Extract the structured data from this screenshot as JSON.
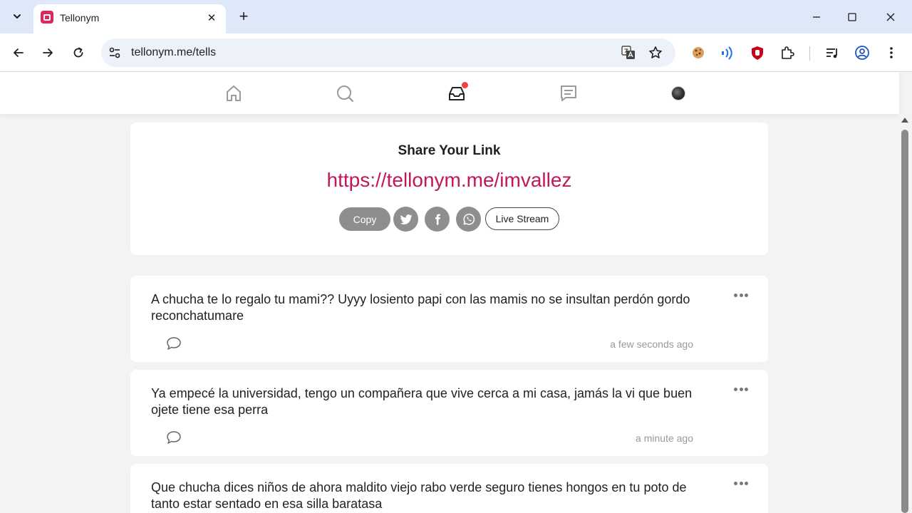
{
  "browser": {
    "tab_title": "Tellonym",
    "url": "tellonym.me/tells",
    "tab_close": "✕",
    "new_tab": "+"
  },
  "share": {
    "title": "Share Your Link",
    "link": "https://tellonym.me/imvallez",
    "copy_label": "Copy",
    "live_label": "Live Stream"
  },
  "tells": [
    {
      "text": "A chucha te lo regalo tu mami?? Uyyy losiento papi con las mamis no se insultan perdón gordo reconchatumare",
      "time": "a few seconds ago"
    },
    {
      "text": "Ya empecé la universidad, tengo un compañera que vive cerca a mi casa, jamás la vi que buen ojete tiene esa perra",
      "time": "a minute ago"
    },
    {
      "text": "Que chucha dices niños de ahora maldito viejo rabo verde seguro tienes hongos en tu poto de tanto estar sentado en esa silla baratasa",
      "time": ""
    }
  ],
  "colors": {
    "accent": "#c2185b",
    "notification": "#ef3e45",
    "button_gray": "#8e8e8e"
  },
  "icons": [
    "home-icon",
    "search-icon",
    "inbox-icon",
    "feed-icon",
    "avatar",
    "twitter-icon",
    "facebook-icon",
    "whatsapp-icon",
    "comment-icon",
    "more-icon"
  ]
}
